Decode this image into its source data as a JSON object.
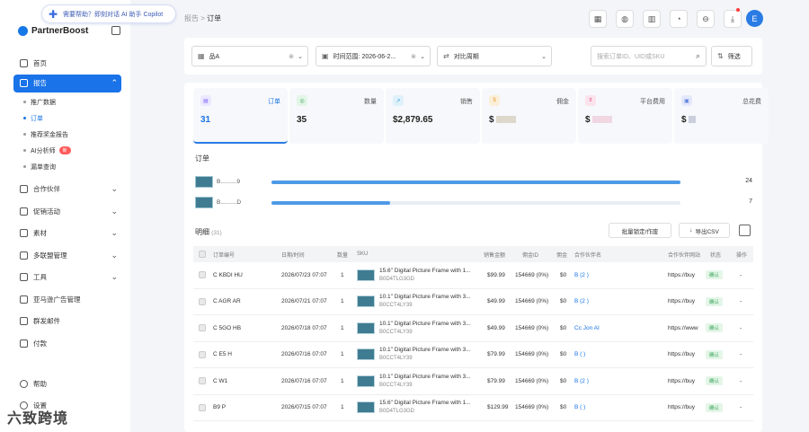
{
  "copilot": {
    "text": "需要帮助？即刻对话 AI 助手 Copilot"
  },
  "brand": {
    "name": "PartnerBoost"
  },
  "sidebar": {
    "items": [
      {
        "label": "首页"
      },
      {
        "label": "报告"
      },
      {
        "label": "合作伙伴"
      },
      {
        "label": "促销活动"
      },
      {
        "label": "素材"
      },
      {
        "label": "多联盟管理"
      },
      {
        "label": "工具"
      },
      {
        "label": "亚马逊广告管理"
      },
      {
        "label": "群发邮件"
      },
      {
        "label": "付款"
      }
    ],
    "report_sub": [
      {
        "label": "推广数据"
      },
      {
        "label": "订单"
      },
      {
        "label": "推荐奖金报告"
      },
      {
        "label": "AI分析师"
      },
      {
        "label": "漏单查询"
      }
    ],
    "new_badge": "新",
    "bottom": [
      {
        "label": "帮助"
      },
      {
        "label": "设置"
      }
    ],
    "watermark": "六致跨境"
  },
  "breadcrumb": {
    "parent": "报告",
    "sep": ">",
    "current": "订单"
  },
  "header": {
    "avatar": "E"
  },
  "filters": {
    "product": "品A",
    "time_range": "时间范围: 2026-06-2...",
    "compare": "对比周期",
    "search_placeholder": "搜索订单ID、UID或SKU",
    "filter_btn": "筛选"
  },
  "stats": [
    {
      "label": "订单",
      "value": "31",
      "color": "#7b61ff",
      "bg": "#ece8ff"
    },
    {
      "label": "数量",
      "value": "35",
      "color": "#3aa55a",
      "bg": "#e2f5e7"
    },
    {
      "label": "销售",
      "value": "$2,879.65",
      "color": "#2a9fd6",
      "bg": "#dff1fa"
    },
    {
      "label": "佣金",
      "value": "$",
      "color": "#e8a33a",
      "bg": "#fcefd9"
    },
    {
      "label": "平台费用",
      "value": "$",
      "color": "#e05a8b",
      "bg": "#fbe3ec"
    },
    {
      "label": "总花费",
      "value": "$",
      "color": "#5b7be0",
      "bg": "#e3e9fb"
    }
  ],
  "orders_section": {
    "title": "订单",
    "bars": [
      {
        "name": "B..........9",
        "count": 24,
        "fraction": 1.0
      },
      {
        "name": "B..........D",
        "count": 7,
        "fraction": 0.29
      }
    ]
  },
  "detail": {
    "title": "明细",
    "count": "(31)",
    "lock_btn": "批量锁定/作废",
    "export_btn": "导出CSV"
  },
  "table": {
    "headers": [
      "订单编号",
      "日期/时间",
      "数量",
      "SKU",
      "销售金额",
      "佣金ID",
      "佣金",
      "合作伙伴名",
      "合作伙伴网站",
      "状态",
      "操作"
    ],
    "rows": [
      {
        "order": "C        KBDI        HU",
        "date": "2026/07/23 07:07",
        "qty": "1",
        "sku1": "15.6\" Digital Picture Frame with 1...",
        "sku2": "B0D4TLG3GD",
        "sales": "$99.99",
        "cid": "154669 (0%)",
        "comm": "$0",
        "partner": "B           (2        )",
        "site": "https://buy",
        "status": "确认",
        "op": "-"
      },
      {
        "order": "C         AGR        AR",
        "date": "2026/07/21 07:07",
        "qty": "1",
        "sku1": "10.1\" Digital Picture Frame with 3...",
        "sku2": "B0CCT4LY39",
        "sales": "$49.99",
        "cid": "154669 (0%)",
        "comm": "$0",
        "partner": "B           (2        )",
        "site": "https://buy",
        "status": "确认",
        "op": "-"
      },
      {
        "order": "C        5GO        HB",
        "date": "2026/07/18 07:07",
        "qty": "1",
        "sku1": "10.1\" Digital Picture Frame with 3...",
        "sku2": "B0CCT4LY39",
        "sales": "$49.99",
        "cid": "154669 (0%)",
        "comm": "$0",
        "partner": "Cc             Jon     AI",
        "site": "https://www",
        "status": "确认",
        "op": "-"
      },
      {
        "order": "C          E5        H",
        "date": "2026/07/16 07:07",
        "qty": "1",
        "sku1": "10.1\" Digital Picture Frame with 3...",
        "sku2": "B0CCT4LY39",
        "sales": "$79.99",
        "cid": "154669 (0%)",
        "comm": "$0",
        "partner": "B           (        )",
        "site": "https://buy",
        "status": "确认",
        "op": "-"
      },
      {
        "order": "C               W1",
        "date": "2026/07/16 07:07",
        "qty": "1",
        "sku1": "10.1\" Digital Picture Frame with 3...",
        "sku2": "B0CCT4LY39",
        "sales": "$79.99",
        "cid": "154669 (0%)",
        "comm": "$0",
        "partner": "B           (2        )",
        "site": "https://buy",
        "status": "确认",
        "op": "-"
      },
      {
        "order": "        B9        P",
        "date": "2026/07/15 07:07",
        "qty": "1",
        "sku1": "15.6\" Digital Picture Frame with 1...",
        "sku2": "B0D4TLG3GD",
        "sales": "$129.99",
        "cid": "154669 (0%)",
        "comm": "$0",
        "partner": "B           (        )",
        "site": "https://buy",
        "status": "确认",
        "op": "-"
      }
    ]
  }
}
